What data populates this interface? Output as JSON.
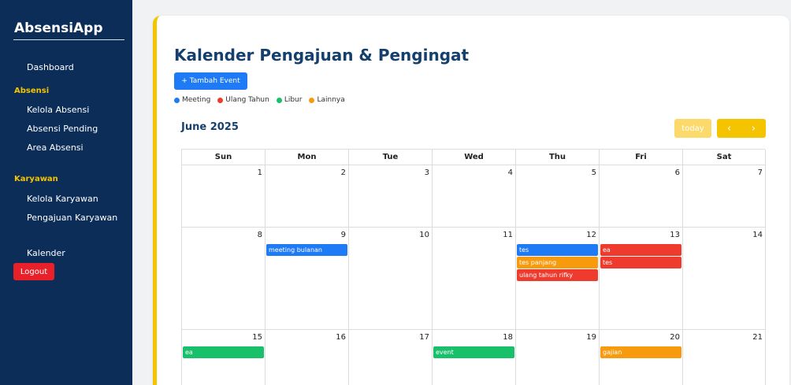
{
  "sidebar": {
    "brand": "AbsensiApp",
    "dashboard": "Dashboard",
    "section_absensi": "Absensi",
    "kelola_absensi": "Kelola Absensi",
    "absensi_pending": "Absensi Pending",
    "area_absensi": "Area Absensi",
    "section_karyawan": "Karyawan",
    "kelola_karyawan": "Kelola Karyawan",
    "pengajuan_karyawan": "Pengajuan Karyawan",
    "kalender": "Kalender",
    "logout": "Logout"
  },
  "main": {
    "title": "Kalender Pengajuan & Pengingat",
    "add_button": "+ Tambah Event",
    "legend": [
      {
        "label": "Meeting",
        "color": "#1e7bf5"
      },
      {
        "label": "Ulang Tahun",
        "color": "#ef3b2d"
      },
      {
        "label": "Libur",
        "color": "#18c06a"
      },
      {
        "label": "Lainnya",
        "color": "#f79a0e"
      }
    ]
  },
  "calendar": {
    "month_title": "June 2025",
    "today_label": "today",
    "prev_icon": "‹",
    "next_icon": "›",
    "weekdays": [
      "Sun",
      "Mon",
      "Tue",
      "Wed",
      "Thu",
      "Fri",
      "Sat"
    ],
    "weeks": [
      {
        "days": [
          {
            "day": "1",
            "events": []
          },
          {
            "day": "2",
            "events": []
          },
          {
            "day": "3",
            "events": []
          },
          {
            "day": "4",
            "events": []
          },
          {
            "day": "5",
            "events": []
          },
          {
            "day": "6",
            "events": []
          },
          {
            "day": "7",
            "events": []
          }
        ]
      },
      {
        "days": [
          {
            "day": "8",
            "events": []
          },
          {
            "day": "9",
            "events": [
              {
                "title": "meeting bulanan",
                "color": "#1e7bf5"
              }
            ]
          },
          {
            "day": "10",
            "events": []
          },
          {
            "day": "11",
            "events": []
          },
          {
            "day": "12",
            "events": [
              {
                "title": "tes",
                "color": "#1e7bf5"
              },
              {
                "title": "tes panjang",
                "color": "#f79a0e"
              },
              {
                "title": "ulang tahun rifky",
                "color": "#ef3b2d"
              }
            ]
          },
          {
            "day": "13",
            "events": [
              {
                "title": "ea",
                "color": "#ef3b2d"
              },
              {
                "title": "tes",
                "color": "#ef3b2d"
              }
            ]
          },
          {
            "day": "14",
            "events": []
          }
        ]
      },
      {
        "days": [
          {
            "day": "15",
            "events": [
              {
                "title": "ea",
                "color": "#18c06a"
              }
            ]
          },
          {
            "day": "16",
            "events": []
          },
          {
            "day": "17",
            "events": []
          },
          {
            "day": "18",
            "events": [
              {
                "title": "event",
                "color": "#18c06a"
              }
            ]
          },
          {
            "day": "19",
            "events": []
          },
          {
            "day": "20",
            "events": [
              {
                "title": "gajian",
                "color": "#f79a0e"
              }
            ]
          },
          {
            "day": "21",
            "events": []
          }
        ]
      }
    ]
  }
}
